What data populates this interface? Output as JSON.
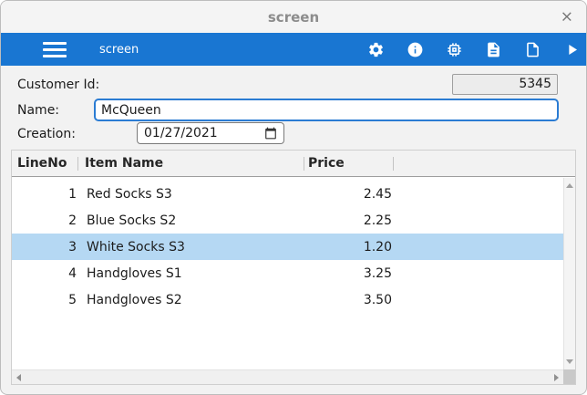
{
  "window": {
    "title": "screen",
    "close": "×"
  },
  "toolbar": {
    "app_label": "screen",
    "icons": [
      "menu-icon",
      "settings-gear-icon",
      "info-icon",
      "chip-icon",
      "document-text-icon",
      "document-blank-icon",
      "run-play-icon"
    ]
  },
  "form": {
    "customer_id": {
      "label": "Customer Id:",
      "value": "5345"
    },
    "name": {
      "label": "Name:",
      "value": "McQueen"
    },
    "creation": {
      "label": "Creation:",
      "value": "01/27/2021"
    }
  },
  "table": {
    "columns": [
      "LineNo",
      "Item Name",
      "Price"
    ],
    "selected_index": 2,
    "rows": [
      {
        "line_no": "1",
        "item_name": "Red Socks S3",
        "price": "2.45"
      },
      {
        "line_no": "2",
        "item_name": "Blue Socks S2",
        "price": "2.25"
      },
      {
        "line_no": "3",
        "item_name": "White Socks S3",
        "price": "1.20"
      },
      {
        "line_no": "4",
        "item_name": "Handgloves S1",
        "price": "3.25"
      },
      {
        "line_no": "5",
        "item_name": "Handgloves S2",
        "price": "3.50"
      }
    ]
  },
  "colors": {
    "toolbar_blue": "#1976d2",
    "selection_blue": "#b5d8f3"
  }
}
